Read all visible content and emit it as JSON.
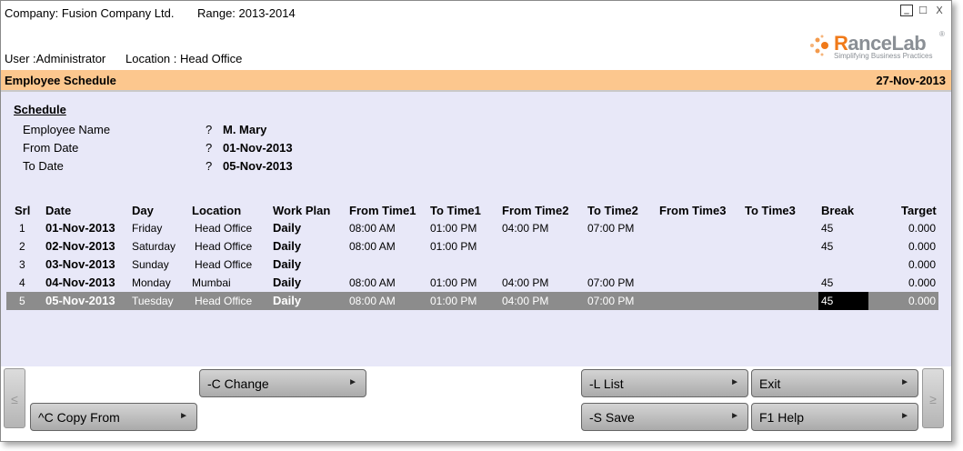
{
  "header": {
    "company": "Company: Fusion Company Ltd.",
    "range": "Range: 2013-2014",
    "user": "User :Administrator",
    "location": "Location : Head Office"
  },
  "window_controls": {
    "minimize": "_",
    "maximize": "☐",
    "close": "X"
  },
  "logo": {
    "name_prefix": "R",
    "name_rest": "anceLab",
    "tagline": "Simplifying Business Practices",
    "reg": "®"
  },
  "title_bar": {
    "title": "Employee Schedule",
    "date": "27-Nov-2013"
  },
  "schedule": {
    "section_title": "Schedule",
    "fields": [
      {
        "label": "Employee Name",
        "q": "?",
        "value": "M. Mary"
      },
      {
        "label": "From Date",
        "q": "?",
        "value": "01-Nov-2013"
      },
      {
        "label": "To Date",
        "q": "?",
        "value": "05-Nov-2013"
      }
    ]
  },
  "grid": {
    "columns": [
      "Srl",
      "Date",
      "Day",
      "Location",
      "Work Plan",
      "From Time1",
      "To Time1",
      "From Time2",
      "To Time2",
      "From Time3",
      "To Time3",
      "Break",
      "Target"
    ],
    "rows": [
      {
        "srl": "1",
        "date": "01-Nov-2013",
        "day": "Friday",
        "location": "Head Office",
        "work_plan": "Daily",
        "from1": "08:00 AM",
        "to1": "01:00 PM",
        "from2": "04:00 PM",
        "to2": "07:00 PM",
        "from3": "",
        "to3": "",
        "break": "45",
        "target": "0.000"
      },
      {
        "srl": "2",
        "date": "02-Nov-2013",
        "day": "Saturday",
        "location": "Head Office",
        "work_plan": "Daily",
        "from1": "08:00 AM",
        "to1": "01:00 PM",
        "from2": "",
        "to2": "",
        "from3": "",
        "to3": "",
        "break": "45",
        "target": "0.000"
      },
      {
        "srl": "3",
        "date": "03-Nov-2013",
        "day": "Sunday",
        "location": "Head Office",
        "work_plan": "Daily",
        "from1": "",
        "to1": "",
        "from2": "",
        "to2": "",
        "from3": "",
        "to3": "",
        "break": "",
        "target": "0.000"
      },
      {
        "srl": "4",
        "date": "04-Nov-2013",
        "day": "Monday",
        "location": "Mumbai",
        "work_plan": "Daily",
        "from1": "08:00 AM",
        "to1": "01:00 PM",
        "from2": "04:00 PM",
        "to2": "07:00 PM",
        "from3": "",
        "to3": "",
        "break": "45",
        "target": "0.000"
      },
      {
        "srl": "5",
        "date": "05-Nov-2013",
        "day": "Tuesday",
        "location": "Head Office",
        "work_plan": "Daily",
        "from1": "08:00 AM",
        "to1": "01:00 PM",
        "from2": "04:00 PM",
        "to2": "07:00 PM",
        "from3": "",
        "to3": "",
        "break": "45",
        "target": "0.000"
      }
    ],
    "selected_row": 5
  },
  "buttons": {
    "scroll_left": "≤",
    "scroll_right": "≥",
    "change": "-C Change",
    "copy_from": "^C Copy From",
    "list": "-L List",
    "save": "-S Save",
    "exit": "Exit",
    "help": "F1 Help",
    "arrow": "►"
  },
  "colors": {
    "title_bar": "#fcc78e",
    "main_bg": "#e8e8f8",
    "selected_row": "#8c8c8c",
    "logo_orange": "#f07a1a"
  }
}
